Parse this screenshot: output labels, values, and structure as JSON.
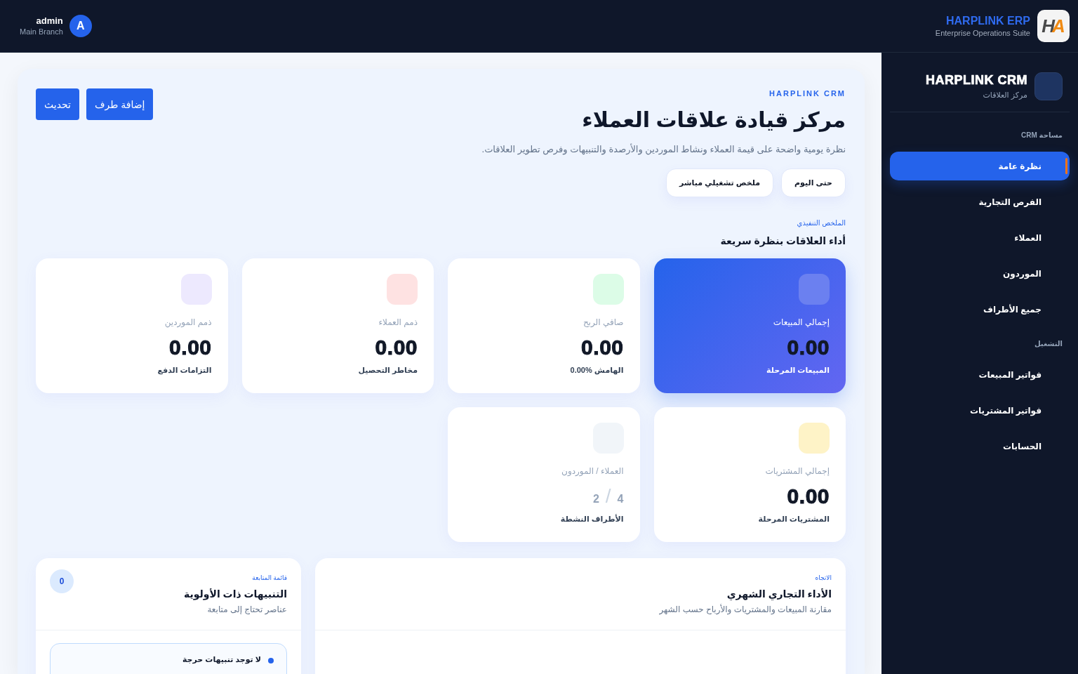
{
  "top_bar": {
    "user": {
      "name": "admin",
      "branch": "Main Branch",
      "initial": "A"
    },
    "brand": {
      "name": "HARPLINK ERP",
      "tagline": "Enterprise Operations Suite",
      "logo": "HA"
    }
  },
  "sidebar": {
    "module": {
      "title": "HARPLINK CRM",
      "subtitle": "مركز العلاقات"
    },
    "sections": [
      {
        "label": "مساحة CRM",
        "items": [
          {
            "label": "نظرة عامة",
            "selected": true
          },
          {
            "label": "الفرص التجارية",
            "selected": false
          },
          {
            "label": "العملاء",
            "selected": false
          },
          {
            "label": "الموردون",
            "selected": false
          },
          {
            "label": "جميع الأطراف",
            "selected": false
          }
        ]
      },
      {
        "label": "التشغيل",
        "items": [
          {
            "label": "فواتير المبيعات",
            "selected": false
          },
          {
            "label": "فواتير المشتريات",
            "selected": false
          },
          {
            "label": "الحسابات",
            "selected": false
          }
        ]
      }
    ]
  },
  "header": {
    "eyebrow": "HARPLINK CRM",
    "title": "مركز قيادة علاقات العملاء",
    "subtitle": "نظرة يومية واضحة على قيمة العملاء ونشاط الموردين والأرصدة والتنبيهات وفرص تطوير العلاقات.",
    "chips": [
      "حتى اليوم",
      "ملخص تشغيلي مباشر"
    ],
    "buttons": [
      "إضافة طرف",
      "تحديث"
    ]
  },
  "summary": {
    "eyebrow": "الملخص التنفيذي",
    "title": "أداء العلاقات بنظرة سريعة",
    "cards": [
      {
        "kind": "amount",
        "featured": true,
        "color": "#6b80f0",
        "label": "إجمالي المبيعات",
        "value": "0.00",
        "note": "المبيعات المرحلة"
      },
      {
        "kind": "amount",
        "featured": false,
        "color": "#dcfce7",
        "label": "صافي الربح",
        "value": "0.00",
        "note": "الهامش %0.00"
      },
      {
        "kind": "amount",
        "featured": false,
        "color": "#fee2e2",
        "label": "ذمم العملاء",
        "value": "0.00",
        "note": "مخاطر التحصيل"
      },
      {
        "kind": "amount",
        "featured": false,
        "color": "#ede9fe",
        "label": "ذمم الموردين",
        "value": "0.00",
        "note": "التزامات الدفع"
      },
      {
        "kind": "amount",
        "featured": false,
        "color": "#fef3c7",
        "label": "إجمالي المشتريات",
        "value": "0.00",
        "note": "المشتريات المرحلة"
      },
      {
        "kind": "ratio",
        "featured": false,
        "color": "#f1f5f9",
        "label": "العملاء / الموردون",
        "values": [
          "4",
          "2"
        ],
        "separator": "/",
        "note": "الأطراف النشطة"
      }
    ]
  },
  "trend_panel": {
    "eyebrow": "الاتجاه",
    "title": "الأداء التجاري الشهري",
    "subtitle": "مقارنة المبيعات والمشتريات والأرباح حسب الشهر"
  },
  "alerts_panel": {
    "eyebrow": "قائمة المتابعة",
    "title": "التنبيهات ذات الأولوية",
    "subtitle": "عناصر تحتاج إلى متابعة",
    "count": "0",
    "alerts": [
      "لا توجد تنبيهات حرجة"
    ]
  }
}
